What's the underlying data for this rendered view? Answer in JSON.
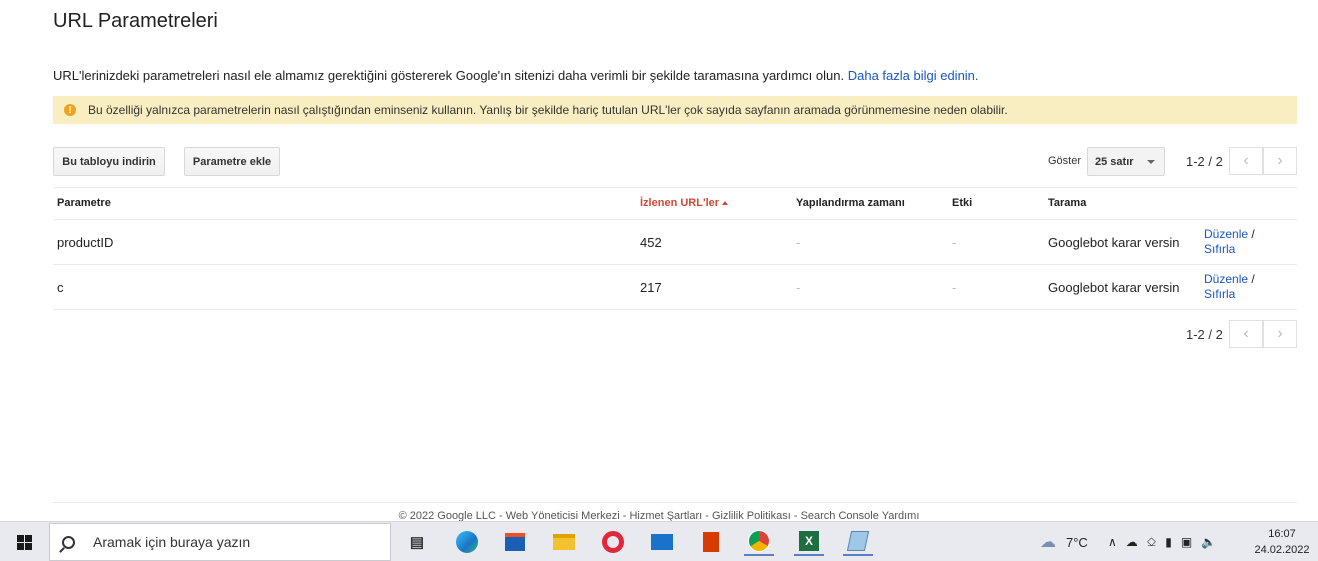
{
  "page": {
    "title": "URL Parametreleri",
    "intro_text": "URL'lerinizdeki parametreleri nasıl ele almamız gerektiğini göstererek Google'ın sitenizi daha verimli bir şekilde taramasına yardımcı olun.",
    "learn_more": "Daha fazla bilgi edinin.",
    "warning": "Bu özelliği yalnızca parametrelerin nasıl çalıştığından eminseniz kullanın. Yanlış bir şekilde hariç tutulan URL'ler çok sayıda sayfanın aramada görünmemesine neden olabilir.",
    "warning_icon": "warning-icon"
  },
  "toolbar": {
    "download_label": "Bu tabloyu indirin",
    "add_label": "Parametre ekle",
    "show_label": "Göster",
    "rows_selected": "25 satır",
    "pager_text": "1-2 / 2"
  },
  "table": {
    "headers": {
      "parameter": "Parametre",
      "monitored_urls": "İzlenen URL'ler",
      "configured": "Yapılandırma zamanı",
      "effect": "Etki",
      "crawl": "Tarama"
    },
    "rows": [
      {
        "parameter": "productID",
        "monitored_urls": "452",
        "configured": "-",
        "effect": "-",
        "crawl": "Googlebot karar versin",
        "edit": "Düzenle",
        "sep": "/",
        "reset": "Sıfırla"
      },
      {
        "parameter": "c",
        "monitored_urls": "217",
        "configured": "-",
        "effect": "-",
        "crawl": "Googlebot karar versin",
        "edit": "Düzenle",
        "sep": "/",
        "reset": "Sıfırla"
      }
    ]
  },
  "footer": {
    "text": "© 2022 Google LLC - Web Yöneticisi Merkezi - Hizmet Şartları - Gizlilik Politikası - Search Console Yardımı"
  },
  "taskbar": {
    "search_placeholder": "Aramak için buraya yazın",
    "temperature": "7°C",
    "time": "16:07",
    "date": "24.02.2022",
    "apps": [
      "task-view-icon",
      "edge-icon",
      "store-icon",
      "file-explorer-icon",
      "opera-icon",
      "mail-icon",
      "office-icon",
      "chrome-icon",
      "excel-icon",
      "notepad-icon"
    ]
  },
  "colors": {
    "link": "#1a56c2",
    "warning_bg": "#f9eec1",
    "warning_icon": "#f0a21a",
    "sorted_header": "#d14836"
  }
}
